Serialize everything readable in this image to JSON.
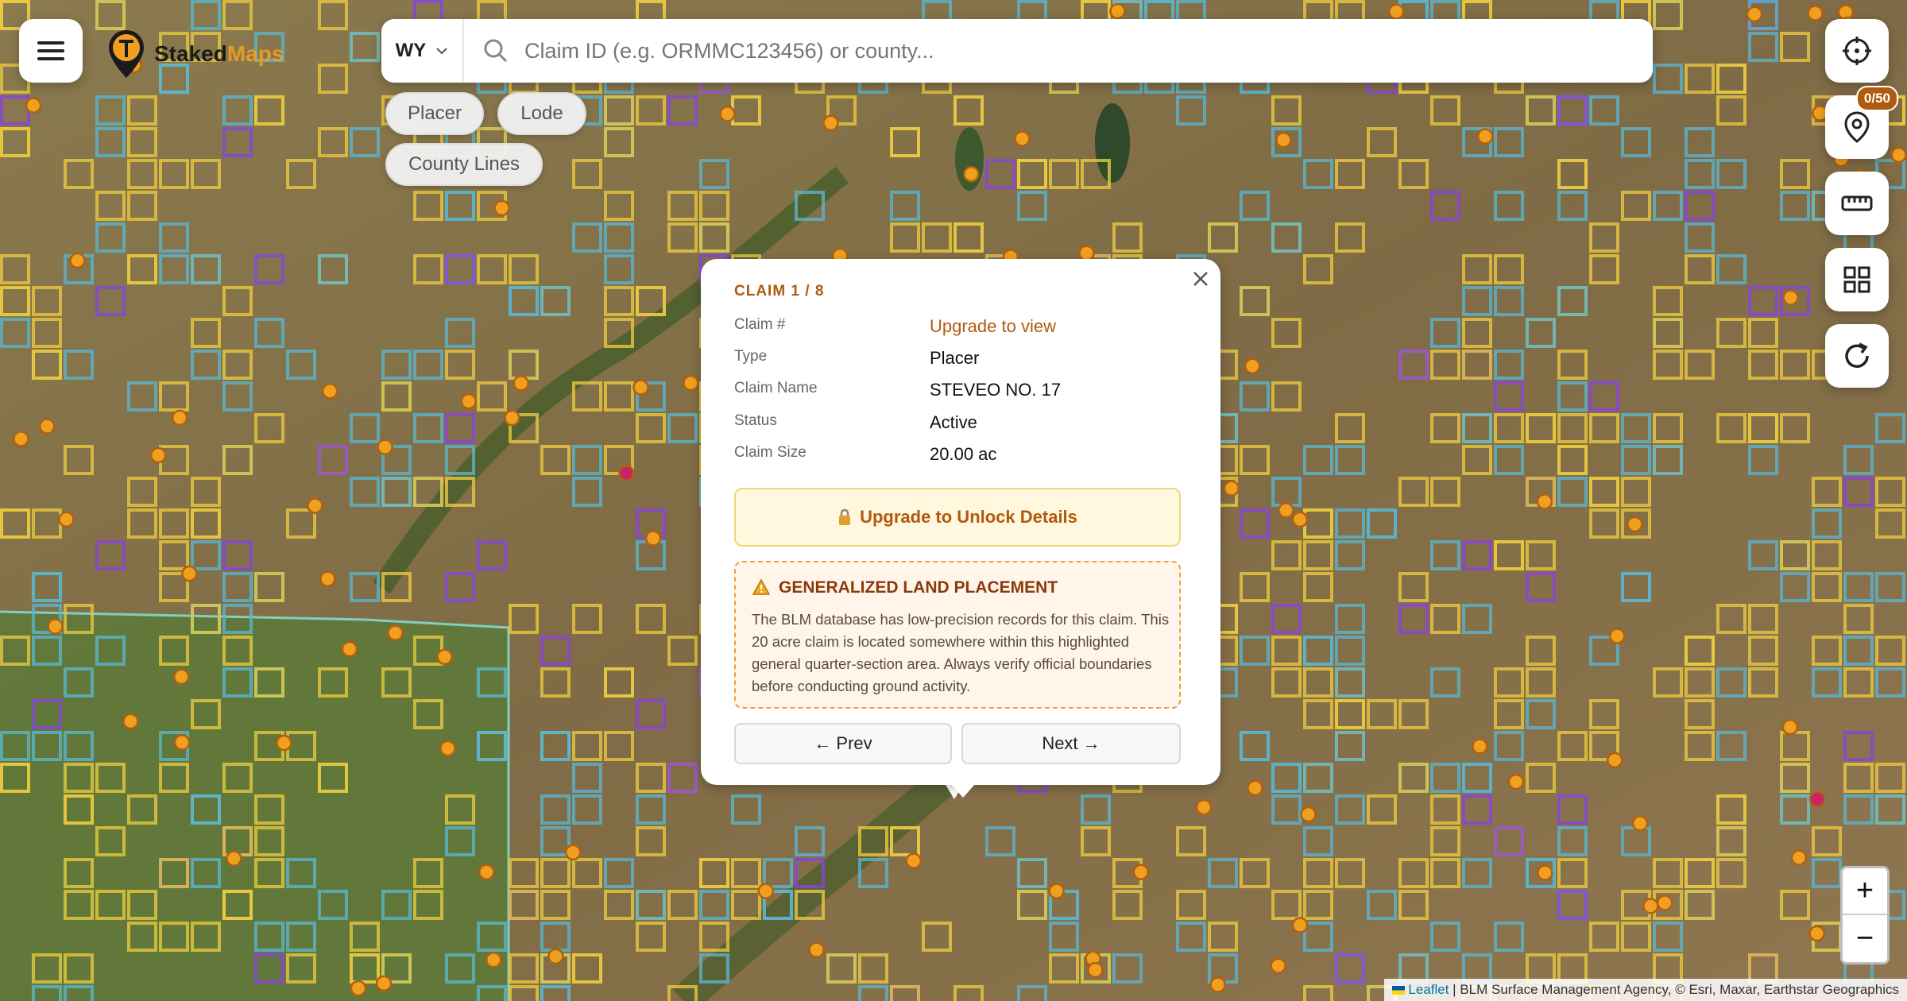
{
  "brand": {
    "name_part1": "Staked",
    "name_part2": "Maps"
  },
  "search": {
    "state": "WY",
    "placeholder": "Claim ID (e.g. ORMMC123456) or county..."
  },
  "filters": {
    "placer": "Placer",
    "lode": "Lode",
    "county_lines": "County Lines"
  },
  "right_toolbar": {
    "pin_badge": "0/50"
  },
  "popup": {
    "header": "CLAIM 1 / 8",
    "fields": [
      {
        "label": "Claim #",
        "value": "Upgrade to view"
      },
      {
        "label": "Type",
        "value": "Placer"
      },
      {
        "label": "Claim Name",
        "value": "STEVEO NO. 17"
      },
      {
        "label": "Status",
        "value": "Active"
      },
      {
        "label": "Claim Size",
        "value": "20.00 ac"
      }
    ],
    "unlock_button": "Upgrade to Unlock Details",
    "warning_title": "GENERALIZED LAND PLACEMENT",
    "warning_text": "The BLM database has low-precision records for this claim. This 20 acre claim is located somewhere within this highlighted general quarter-section area. Always verify official boundaries before conducting ground activity.",
    "prev": "← Prev",
    "next": "Next →"
  },
  "zoom": {
    "in": "+",
    "out": "−"
  },
  "attribution": {
    "leaflet": "Leaflet",
    "rest": " | BLM Surface Management Agency, © Esri, Maxar, Earthstar Geographics"
  },
  "colors": {
    "placer": "#e8c840",
    "lode": "#5ab4cc",
    "purple": "#8844dd",
    "accent": "#b05a10",
    "marker": "#f0a020",
    "marker_red": "#cc2266"
  }
}
